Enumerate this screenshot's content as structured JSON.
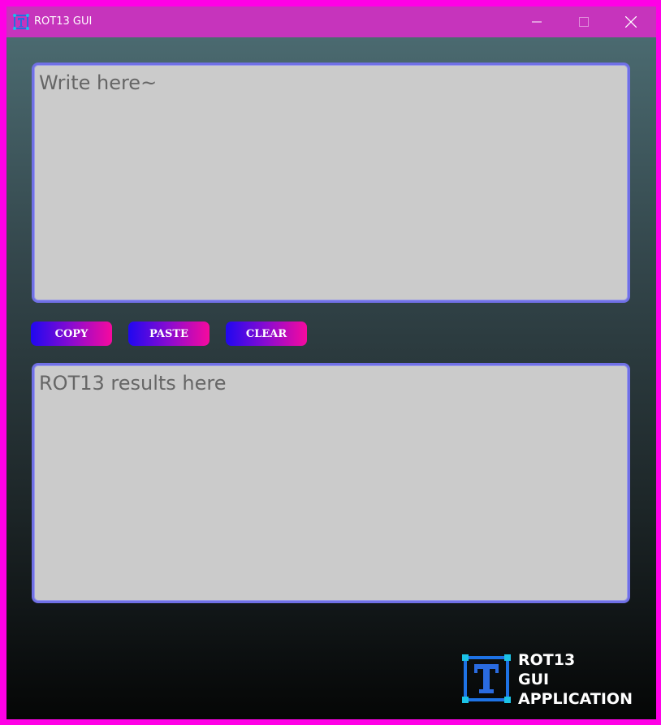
{
  "window": {
    "title": "ROT13 GUI",
    "controls": {
      "minimize": "—",
      "maximize": "☐",
      "close": "✕"
    }
  },
  "input": {
    "placeholder": "Write here~",
    "value": ""
  },
  "output": {
    "placeholder": "ROT13 results here",
    "value": ""
  },
  "buttons": {
    "copy": "COPY",
    "paste": "PASTE",
    "clear": "CLEAR"
  },
  "logo": {
    "line1": "ROT13",
    "line2": "GUI",
    "line3": "APPLICATION",
    "icon": "T-letter-icon"
  },
  "colors": {
    "title_bar": "#c634bc",
    "outer_border": "#ff00e6",
    "textbox_border": "#7070e6",
    "textbox_bg": "#cbcbcb",
    "button_gradient_start": "#2008f0",
    "button_gradient_end": "#f60a9e"
  }
}
